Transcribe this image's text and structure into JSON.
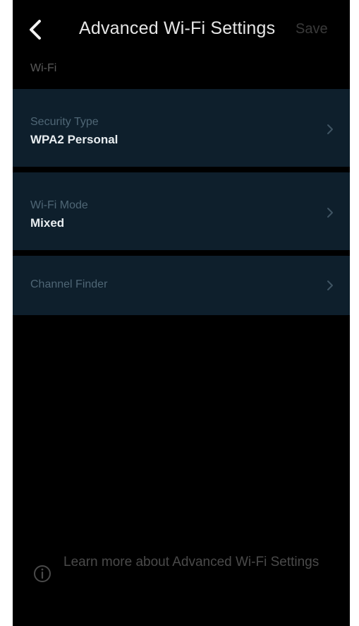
{
  "header": {
    "title": "Advanced Wi-Fi Settings",
    "save_label": "Save",
    "back_icon": "chevron-left-icon"
  },
  "section": {
    "label": "Wi-Fi"
  },
  "rows": [
    {
      "label": "Security Type",
      "value": "WPA2 Personal",
      "icon": "chevron-right-icon"
    },
    {
      "label": "Wi-Fi Mode",
      "value": "Mixed",
      "icon": "chevron-right-icon"
    },
    {
      "label": "Channel Finder",
      "icon": "chevron-right-icon"
    }
  ],
  "footer": {
    "text": "Learn more about Advanced Wi-Fi Settings",
    "icon": "info-icon"
  },
  "colors": {
    "background": "#000000",
    "row_background": "#0e1f2c",
    "title_text": "#e6e6e6",
    "save_disabled": "#3a3a3a",
    "row_label": "#4f6675",
    "row_value": "#e8edf0",
    "footer_text": "#4a4a4a"
  }
}
